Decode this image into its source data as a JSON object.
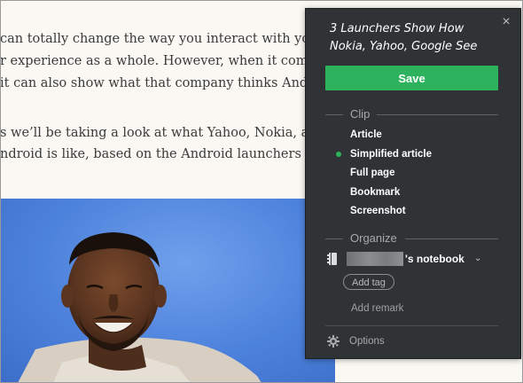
{
  "article": {
    "lines": [
      "can totally change the way you interact with your Andr",
      "r experience as a whole. However, when it comes from a",
      "it can also show what that company thinks Android sho",
      "s we’ll be taking a look at what Yahoo, Nokia, and Goo",
      "ndroid is like, based on the Android launchers they’ve r"
    ]
  },
  "clipper": {
    "title": "3 Launchers Show How Nokia, Yahoo, Google See",
    "close_icon": "×",
    "save_label": "Save",
    "clip_section": "Clip",
    "clip_options": [
      "Article",
      "Simplified article",
      "Full page",
      "Bookmark",
      "Screenshot"
    ],
    "selected_option": "Simplified article",
    "organize_section": "Organize",
    "notebook_suffix": "'s notebook",
    "chevron": "⌄",
    "add_tag_label": "Add tag",
    "add_remark_placeholder": "Add remark",
    "options_label": "Options"
  },
  "colors": {
    "panel_bg": "#2f3335",
    "accent_green": "#2db35d",
    "hero_blue": "#4d82dc"
  },
  "icons": {
    "close": "close-icon",
    "notebook": "notebook-icon",
    "chevron": "chevron-down-icon",
    "options": "gear-icon",
    "selected": "selected-dot-icon"
  }
}
